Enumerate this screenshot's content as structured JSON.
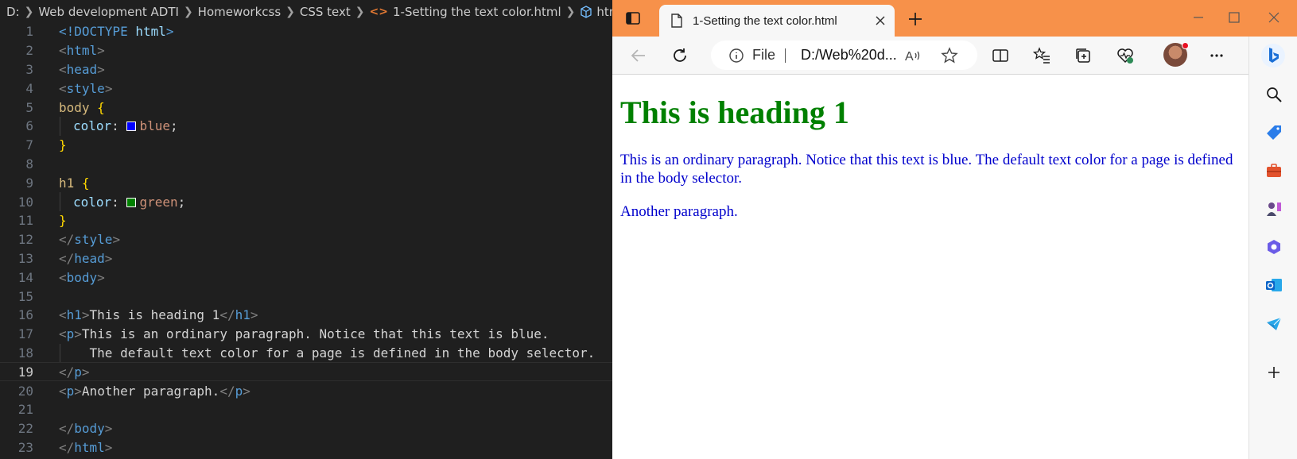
{
  "editor": {
    "breadcrumb": {
      "items": [
        "D:",
        "Web development ADTI",
        "Homeworkcss",
        "CSS text",
        "1-Setting the text color.html",
        "html"
      ]
    },
    "code": {
      "l1": {
        "num": "1",
        "a": "<!",
        "b": "DOCTYPE",
        "c": " html",
        "d": ">"
      },
      "l2": {
        "num": "2",
        "a": "<",
        "b": "html",
        "c": ">"
      },
      "l3": {
        "num": "3",
        "a": "<",
        "b": "head",
        "c": ">"
      },
      "l4": {
        "num": "4",
        "a": "<",
        "b": "style",
        "c": ">"
      },
      "l5": {
        "num": "5",
        "a": "body",
        "b": " {"
      },
      "l6": {
        "num": "6",
        "a": "color",
        "b": ": ",
        "c": "blue",
        "d": ";",
        "swatch": "#0000ff"
      },
      "l7": {
        "num": "7",
        "a": "}"
      },
      "l8": {
        "num": "8"
      },
      "l9": {
        "num": "9",
        "a": "h1",
        "b": " {"
      },
      "l10": {
        "num": "10",
        "a": "color",
        "b": ": ",
        "c": "green",
        "d": ";",
        "swatch": "#008000"
      },
      "l11": {
        "num": "11",
        "a": "}"
      },
      "l12": {
        "num": "12",
        "a": "</",
        "b": "style",
        "c": ">"
      },
      "l13": {
        "num": "13",
        "a": "</",
        "b": "head",
        "c": ">"
      },
      "l14": {
        "num": "14",
        "a": "<",
        "b": "body",
        "c": ">"
      },
      "l15": {
        "num": "15"
      },
      "l16": {
        "num": "16",
        "a": "<",
        "b": "h1",
        "c": ">",
        "d": "This is heading 1",
        "e": "</",
        "f": "h1",
        "g": ">"
      },
      "l17": {
        "num": "17",
        "a": "<",
        "b": "p",
        "c": ">",
        "d": "This is an ordinary paragraph. Notice that this text is blue."
      },
      "l18": {
        "num": "18",
        "a": "    The default text color for a page is defined in the body selector."
      },
      "l19": {
        "num": "19",
        "a": "</",
        "b": "p",
        "c": ">"
      },
      "l20": {
        "num": "20",
        "a": "<",
        "b": "p",
        "c": ">",
        "d": "Another paragraph.",
        "e": "</",
        "f": "p",
        "g": ">"
      },
      "l21": {
        "num": "21"
      },
      "l22": {
        "num": "22",
        "a": "</",
        "b": "body",
        "c": ">"
      },
      "l23": {
        "num": "23",
        "a": "</",
        "b": "html",
        "c": ">"
      }
    }
  },
  "browser": {
    "titlebar_color": "#f7914a",
    "tab": {
      "title": "1-Setting the text color.html"
    },
    "address": {
      "scheme_label": "File",
      "url": "D:/Web%20d..."
    },
    "page": {
      "heading": "This is heading 1",
      "heading_color": "#008000",
      "paragraph1": "This is an ordinary paragraph. Notice that this text is blue. The default text color for a page is defined in the body selector.",
      "paragraph2": "Another paragraph.",
      "text_color": "#0000cc"
    },
    "toolbar_icons": [
      "back-icon",
      "refresh-icon",
      "info-icon",
      "read-aloud-icon",
      "favorite-star-icon",
      "split-screen-icon",
      "favorites-icon",
      "collections-icon",
      "browser-essentials-icon",
      "avatar",
      "more-icon",
      "bing-copilot-icon"
    ],
    "sidebar_icons": [
      "search-icon",
      "shopping-tag-icon",
      "tools-briefcase-icon",
      "games-icon",
      "microsoft-365-icon",
      "outlook-icon",
      "drop-icon",
      "add-icon"
    ]
  }
}
